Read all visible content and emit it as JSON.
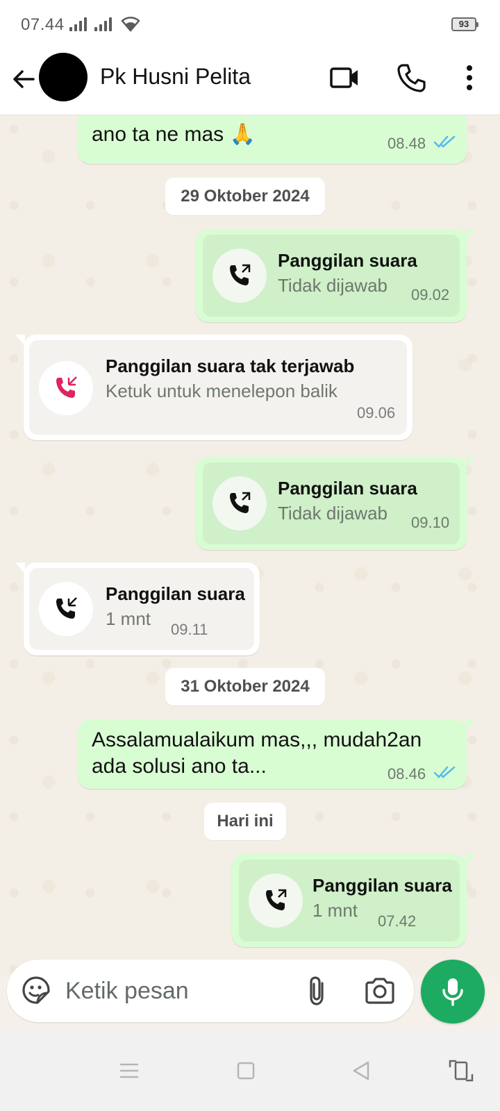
{
  "status_bar": {
    "time": "07.44",
    "battery": "93"
  },
  "header": {
    "contact_name": "Pk Husni Pelita"
  },
  "messages": [
    {
      "direction": "out",
      "text": "ano ta ne mas 🙏",
      "time": "08.48",
      "read": true
    },
    {
      "type": "date",
      "text": "29 Oktober 2024"
    },
    {
      "direction": "out",
      "type": "call",
      "title": "Panggilan suara",
      "subtitle": "Tidak dijawab",
      "time": "09.02"
    },
    {
      "direction": "in",
      "type": "call",
      "title": "Panggilan suara tak terjawab",
      "subtitle": "Ketuk untuk menelepon balik",
      "time": "09.06",
      "missed": true
    },
    {
      "direction": "out",
      "type": "call",
      "title": "Panggilan suara",
      "subtitle": "Tidak dijawab",
      "time": "09.10"
    },
    {
      "direction": "in",
      "type": "call",
      "title": "Panggilan suara",
      "subtitle": "1 mnt",
      "time": "09.11"
    },
    {
      "type": "date",
      "text": "31 Oktober 2024"
    },
    {
      "direction": "out",
      "text_line1": "Assalamualaikum mas,,, mudah2an",
      "text_line2": "ada solusi ano ta...",
      "time": "08.46",
      "read": true
    },
    {
      "type": "date",
      "text": "Hari ini"
    },
    {
      "direction": "out",
      "type": "call",
      "title": "Panggilan suara",
      "subtitle": "1 mnt",
      "time": "07.42"
    }
  ],
  "composer": {
    "placeholder": "Ketik pesan"
  },
  "colors": {
    "outgoing_bubble": "#d9fdd3",
    "incoming_bubble": "#ffffff",
    "read_ticks": "#53bdeb",
    "missed_call": "#e0245e",
    "mic_button": "#1daa61"
  }
}
